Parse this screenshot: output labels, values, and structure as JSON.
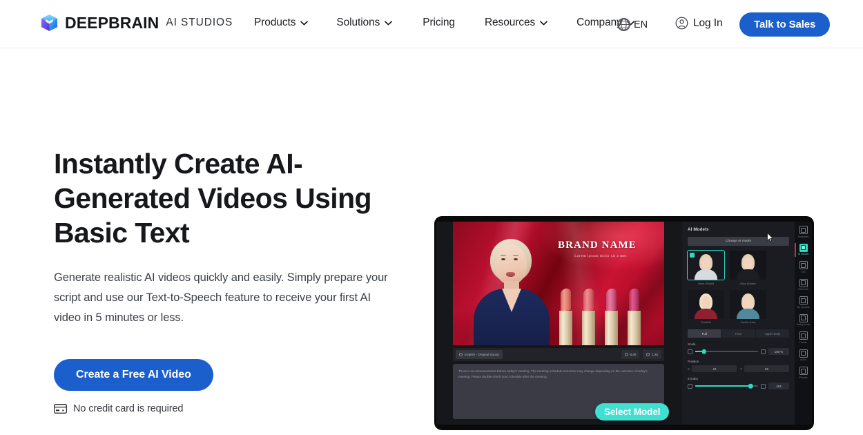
{
  "header": {
    "brand": {
      "name": "DEEPBRAIN",
      "sub": "AI STUDIOS",
      "icon": "cube-logo-icon"
    },
    "nav": [
      {
        "label": "Products",
        "has_caret": true
      },
      {
        "label": "Solutions",
        "has_caret": true
      },
      {
        "label": "Pricing",
        "has_caret": false
      },
      {
        "label": "Resources",
        "has_caret": true
      },
      {
        "label": "Company",
        "has_caret": true
      }
    ],
    "language": {
      "code": "EN",
      "icon": "globe-icon"
    },
    "login": {
      "label": "Log In",
      "icon": "user-circle-icon"
    },
    "cta": {
      "label": "Talk to Sales"
    }
  },
  "hero": {
    "headline": "Instantly Create AI-Generated Videos Using Basic Text",
    "subcopy": "Generate realistic AI videos quickly and easily. Simply prepare your script and use our Text-to-Speech feature to receive your first AI video in 5 minutes or less.",
    "cta_label": "Create a Free AI Video",
    "note": "No credit card is required",
    "note_icon": "credit-card-icon"
  },
  "studio": {
    "canvas": {
      "brand_name": "BRAND NAME",
      "brand_tagline": "Lorem ipsum dolor sit a met",
      "presenter_alt": "ai-avatar-presenter",
      "product_alt": "lipstick-products"
    },
    "canvas_bar": {
      "language_chip": "English - Original Sound",
      "duration": "0.0s",
      "total": "1.4s"
    },
    "script": "There is an announcement before today's meeting. The meeting schedule tomorrow may change depending on the outcome of today's meeting. Please double-check your schedule after the meeting.",
    "select_model_badge": "Select Model",
    "panel": {
      "title": "AI Models",
      "change_button": "Change AI model",
      "models": [
        {
          "name": "Hana (Smart)",
          "selected": true,
          "body_color": "#cfd3da"
        },
        {
          "name": "Mina (Smart)",
          "selected": false,
          "body_color": "#1b1c22"
        },
        {
          "name": "Rosalind",
          "selected": false,
          "body_color": "#8f2030"
        },
        {
          "name": "Sophia (Lite)",
          "selected": false,
          "body_color": "#3f7f93"
        }
      ],
      "tabs": [
        {
          "label": "Full",
          "active": true
        },
        {
          "label": "Face",
          "active": false
        },
        {
          "label": "Upper body",
          "active": false
        }
      ],
      "controls": [
        {
          "label": "Scale",
          "value": "100 %",
          "fill_pct": 14
        },
        {
          "label": "Z index",
          "value": "404",
          "fill_pct": 88
        }
      ],
      "position": {
        "label": "Position",
        "x_key": "X",
        "x_value": "-24",
        "y_key": "Y",
        "y_value": "65"
      }
    },
    "rail": [
      {
        "label": "Templates",
        "active": false
      },
      {
        "label": "AI Models",
        "active": true
      },
      {
        "label": "Text",
        "active": false
      },
      {
        "label": "Elements",
        "active": false
      },
      {
        "label": "My Uploads",
        "active": false
      },
      {
        "label": "Backgrounds",
        "active": false
      },
      {
        "label": "Frames",
        "active": false
      },
      {
        "label": "Audio",
        "active": false
      },
      {
        "label": "IPcenter",
        "active": false
      }
    ]
  },
  "colors": {
    "brand_blue": "#1b5fcc",
    "accent_teal": "#3fdfd2",
    "text_dark": "#16181c"
  }
}
